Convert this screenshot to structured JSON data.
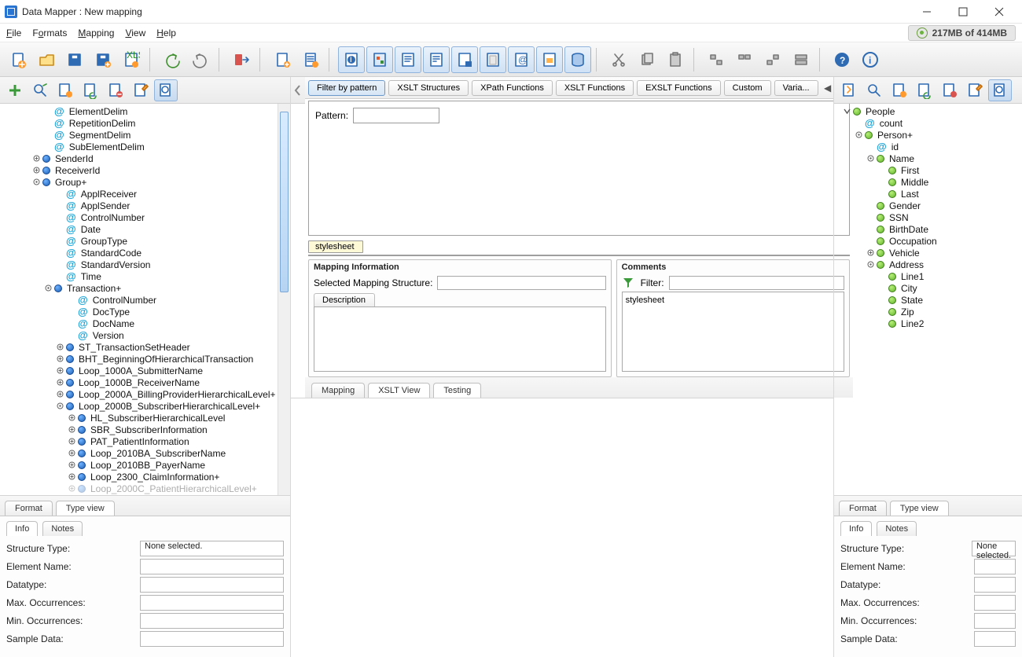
{
  "window": {
    "title": "Data Mapper : New mapping"
  },
  "menu": {
    "file": "File",
    "formats": "Formats",
    "mapping": "Mapping",
    "view": "View",
    "help": "Help"
  },
  "memory": "217MB of 414MB",
  "left_tree": [
    {
      "d": 3,
      "t": "at",
      "label": "ElementDelim"
    },
    {
      "d": 3,
      "t": "at",
      "label": "RepetitionDelim"
    },
    {
      "d": 3,
      "t": "at",
      "label": "SegmentDelim"
    },
    {
      "d": 3,
      "t": "at",
      "label": "SubElementDelim"
    },
    {
      "d": 2,
      "t": "blue",
      "label": "SenderId",
      "tw": "closed"
    },
    {
      "d": 2,
      "t": "blue",
      "label": "ReceiverId",
      "tw": "closed"
    },
    {
      "d": 2,
      "t": "blue",
      "label": "Group+",
      "tw": "open"
    },
    {
      "d": 4,
      "t": "at",
      "label": "ApplReceiver"
    },
    {
      "d": 4,
      "t": "at",
      "label": "ApplSender"
    },
    {
      "d": 4,
      "t": "at",
      "label": "ControlNumber"
    },
    {
      "d": 4,
      "t": "at",
      "label": "Date"
    },
    {
      "d": 4,
      "t": "at",
      "label": "GroupType"
    },
    {
      "d": 4,
      "t": "at",
      "label": "StandardCode"
    },
    {
      "d": 4,
      "t": "at",
      "label": "StandardVersion"
    },
    {
      "d": 4,
      "t": "at",
      "label": "Time"
    },
    {
      "d": 3,
      "t": "blue",
      "label": "Transaction+",
      "tw": "open"
    },
    {
      "d": 5,
      "t": "at",
      "label": "ControlNumber"
    },
    {
      "d": 5,
      "t": "at",
      "label": "DocType"
    },
    {
      "d": 5,
      "t": "at",
      "label": "DocName"
    },
    {
      "d": 5,
      "t": "at",
      "label": "Version"
    },
    {
      "d": 4,
      "t": "blue",
      "label": "ST_TransactionSetHeader",
      "tw": "closed"
    },
    {
      "d": 4,
      "t": "blue",
      "label": "BHT_BeginningOfHierarchicalTransaction",
      "tw": "closed"
    },
    {
      "d": 4,
      "t": "blue",
      "label": "Loop_1000A_SubmitterName",
      "tw": "closed"
    },
    {
      "d": 4,
      "t": "blue",
      "label": "Loop_1000B_ReceiverName",
      "tw": "closed"
    },
    {
      "d": 4,
      "t": "blue",
      "label": "Loop_2000A_BillingProviderHierarchicalLevel+",
      "tw": "closed"
    },
    {
      "d": 4,
      "t": "blue",
      "label": "Loop_2000B_SubscriberHierarchicalLevel+",
      "tw": "open"
    },
    {
      "d": 5,
      "t": "blue",
      "label": "HL_SubscriberHierarchicalLevel",
      "tw": "closed"
    },
    {
      "d": 5,
      "t": "blue",
      "label": "SBR_SubscriberInformation",
      "tw": "closed"
    },
    {
      "d": 5,
      "t": "blue",
      "label": "PAT_PatientInformation",
      "tw": "closed"
    },
    {
      "d": 5,
      "t": "blue",
      "label": "Loop_2010BA_SubscriberName",
      "tw": "closed"
    },
    {
      "d": 5,
      "t": "blue",
      "label": "Loop_2010BB_PayerName",
      "tw": "closed"
    },
    {
      "d": 5,
      "t": "blue",
      "label": "Loop_2300_ClaimInformation+",
      "tw": "closed"
    },
    {
      "d": 5,
      "t": "blue",
      "label": "Loop_2000C_PatientHierarchicalLevel+",
      "tw": "closed",
      "cut": true
    }
  ],
  "left_bot_tabs": {
    "format": "Format",
    "type_view": "Type view"
  },
  "info_tabs": {
    "info": "Info",
    "notes": "Notes"
  },
  "info_fields": {
    "structure_type_label": "Structure Type:",
    "structure_type_value": "None selected.",
    "element_name": "Element Name:",
    "datatype": "Datatype:",
    "max_occ": "Max. Occurrences:",
    "min_occ": "Min. Occurrences:",
    "sample": "Sample Data:"
  },
  "center_tabs": {
    "filter": "Filter by pattern",
    "xslt_struct": "XSLT Structures",
    "xpath": "XPath Functions",
    "xslt_fn": "XSLT Functions",
    "exslt": "EXSLT Functions",
    "custom": "Custom",
    "varia": "Varia..."
  },
  "filter": {
    "label": "Pattern:"
  },
  "chip": "stylesheet",
  "mapping_info": {
    "title": "Mapping Information",
    "sel_label": "Selected Mapping Structure:",
    "desc_tab": "Description"
  },
  "comments": {
    "title": "Comments",
    "filter_label": "Filter:",
    "body": "stylesheet"
  },
  "center_bot_tabs": {
    "mapping": "Mapping",
    "xslt_view": "XSLT View",
    "testing": "Testing"
  },
  "right_tree": [
    {
      "d": 0,
      "t": "green",
      "label": "People",
      "tw": "open-down"
    },
    {
      "d": 1,
      "t": "at",
      "label": "count"
    },
    {
      "d": 1,
      "t": "green",
      "label": "Person+",
      "tw": "open"
    },
    {
      "d": 2,
      "t": "at",
      "label": "id"
    },
    {
      "d": 2,
      "t": "green",
      "label": "Name",
      "tw": "open"
    },
    {
      "d": 3,
      "t": "green",
      "label": "First"
    },
    {
      "d": 3,
      "t": "green",
      "label": "Middle"
    },
    {
      "d": 3,
      "t": "green",
      "label": "Last"
    },
    {
      "d": 2,
      "t": "green",
      "label": "Gender"
    },
    {
      "d": 2,
      "t": "green",
      "label": "SSN"
    },
    {
      "d": 2,
      "t": "green",
      "label": "BirthDate"
    },
    {
      "d": 2,
      "t": "green",
      "label": "Occupation"
    },
    {
      "d": 2,
      "t": "green",
      "label": "Vehicle",
      "tw": "closed"
    },
    {
      "d": 2,
      "t": "green",
      "label": "Address",
      "tw": "open"
    },
    {
      "d": 3,
      "t": "green",
      "label": "Line1"
    },
    {
      "d": 3,
      "t": "green",
      "label": "City"
    },
    {
      "d": 3,
      "t": "green",
      "label": "State"
    },
    {
      "d": 3,
      "t": "green",
      "label": "Zip"
    },
    {
      "d": 3,
      "t": "green",
      "label": "Line2"
    }
  ],
  "right_bot_tabs": {
    "format": "Format",
    "type_view": "Type view"
  },
  "right_info_fields": {
    "structure_type_label": "Structure Type:",
    "structure_type_value": "None selected.",
    "element_name": "Element Name:",
    "datatype": "Datatype:",
    "max_occ": "Max. Occurrences:",
    "min_occ": "Min. Occurrences:",
    "sample": "Sample Data:"
  }
}
